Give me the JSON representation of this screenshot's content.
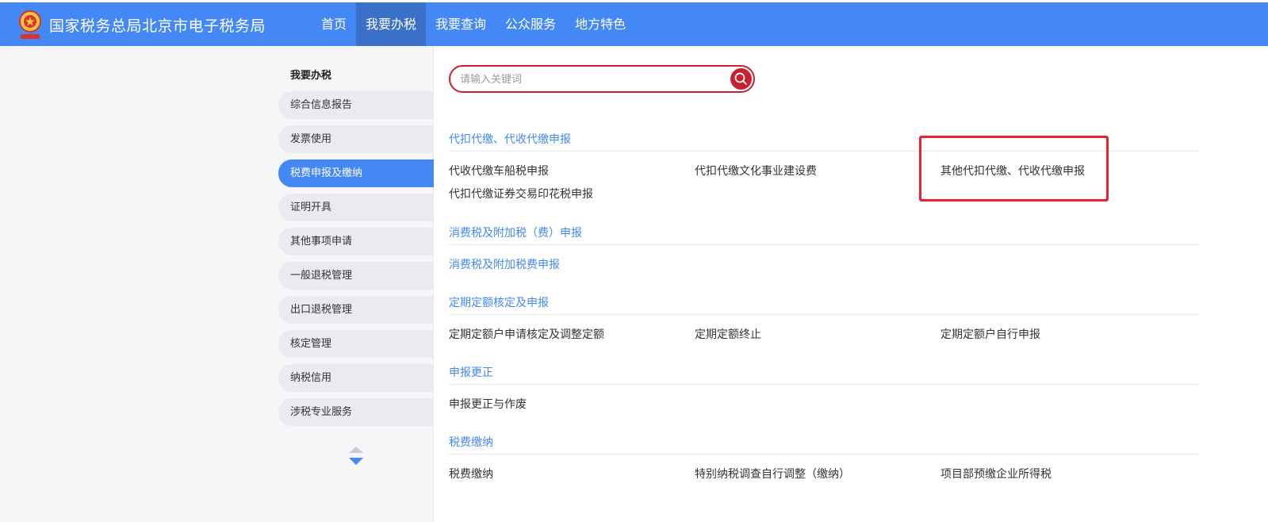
{
  "header": {
    "logo_icon": "tax-emblem-icon",
    "site_title": "国家税务总局北京市电子税务局",
    "nav": [
      {
        "label": "首页",
        "active": false
      },
      {
        "label": "我要办税",
        "active": true
      },
      {
        "label": "我要查询",
        "active": false
      },
      {
        "label": "公众服务",
        "active": false
      },
      {
        "label": "地方特色",
        "active": false
      }
    ]
  },
  "sidebar": {
    "heading": "我要办税",
    "items": [
      {
        "label": "综合信息报告",
        "active": false
      },
      {
        "label": "发票使用",
        "active": false
      },
      {
        "label": "税费申报及缴纳",
        "active": true
      },
      {
        "label": "证明开具",
        "active": false
      },
      {
        "label": "其他事项申请",
        "active": false
      },
      {
        "label": "一般退税管理",
        "active": false
      },
      {
        "label": "出口退税管理",
        "active": false
      },
      {
        "label": "核定管理",
        "active": false
      },
      {
        "label": "纳税信用",
        "active": false
      },
      {
        "label": "涉税专业服务",
        "active": false
      }
    ]
  },
  "search": {
    "placeholder": "请输入关键词",
    "value": "",
    "icon": "search-icon"
  },
  "sections": [
    {
      "title": "代扣代缴、代收代缴申报",
      "links": [
        "代收代缴车船税申报",
        "代扣代缴文化事业建设费",
        "其他代扣代缴、代收代缴申报",
        "代扣代缴证券交易印花税申报"
      ]
    },
    {
      "title": "消费税及附加税（费）申报",
      "links": [
        "消费税及附加税费申报"
      ]
    },
    {
      "title": "定期定额核定及申报",
      "links": [
        "定期定额户申请核定及调整定额",
        "定期定额终止",
        "定期定额户自行申报"
      ]
    },
    {
      "title": "申报更正",
      "links": [
        "申报更正与作废"
      ]
    },
    {
      "title": "税费缴纳",
      "links": [
        "税费缴纳",
        "特别纳税调查自行调整（缴纳）",
        "项目部预缴企业所得税"
      ]
    }
  ],
  "colors": {
    "header_bg": "#4488f5",
    "nav_active_bg": "#3b70c8",
    "section_title": "#4488f5",
    "search_border": "#c8202c",
    "highlight": "#e8232e"
  }
}
